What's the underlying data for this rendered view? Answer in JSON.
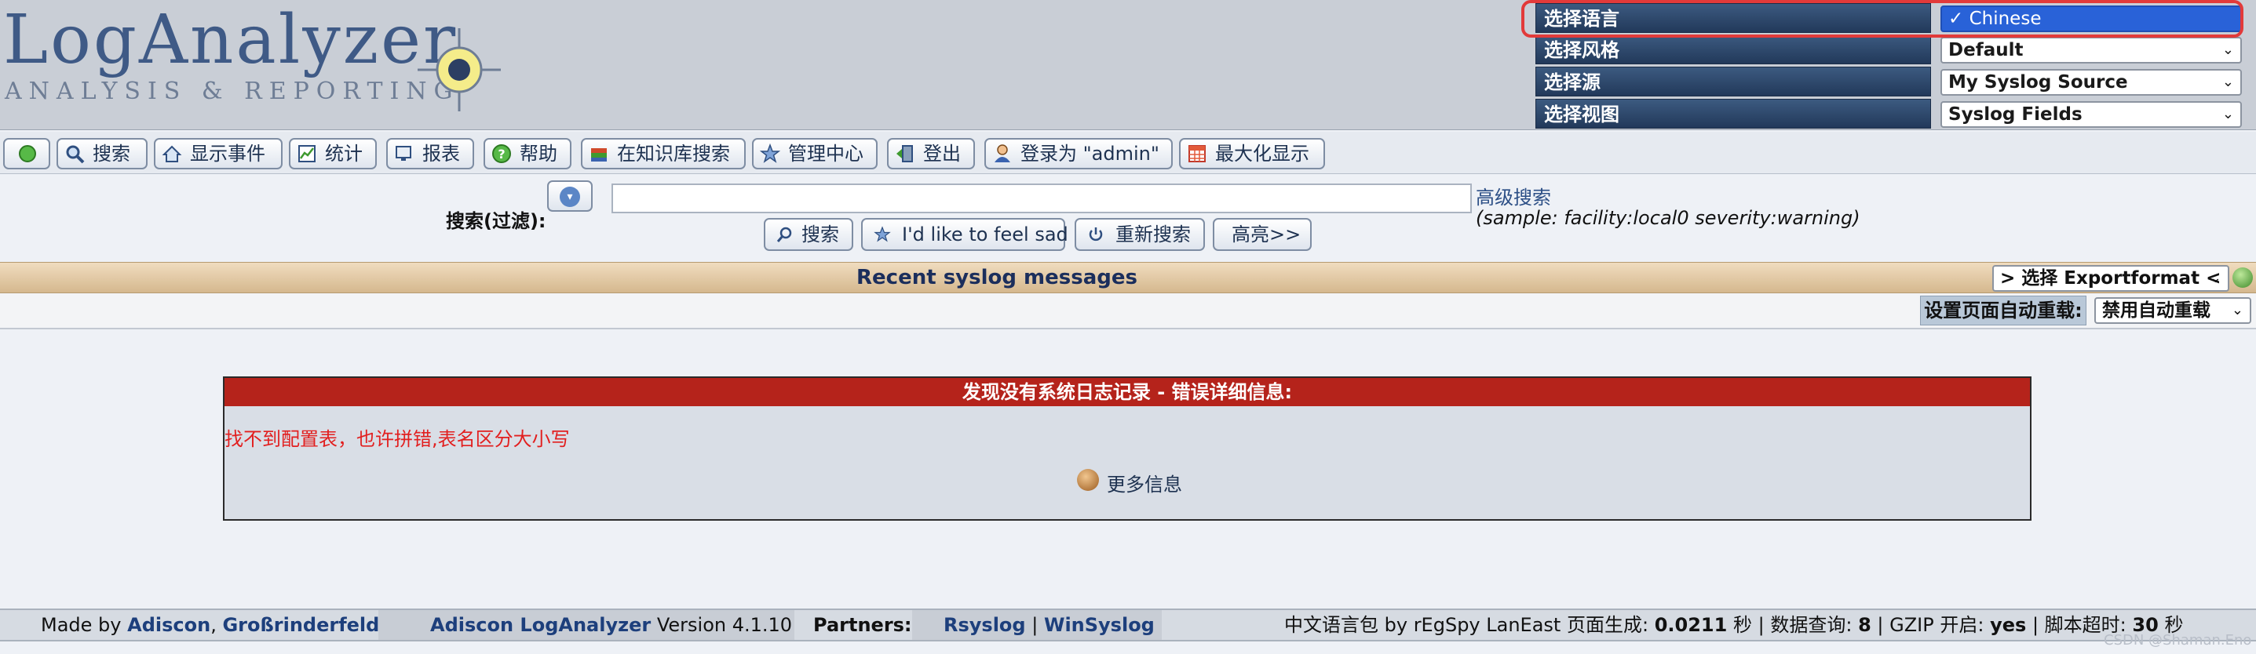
{
  "logo": {
    "title": "LogAnalyzer",
    "subtitle": "ANALYSIS & REPORTING"
  },
  "settings": [
    {
      "label": "选择语言",
      "value": "✓ Chinese",
      "open": true
    },
    {
      "label": "选择风格",
      "value": "Default"
    },
    {
      "label": "选择源",
      "value": "My Syslog Source"
    },
    {
      "label": "选择视图",
      "value": "Syslog Fields"
    }
  ],
  "toolbar": {
    "items": [
      {
        "label": ""
      },
      {
        "label": "搜索"
      },
      {
        "label": "显示事件"
      },
      {
        "label": "统计"
      },
      {
        "label": "报表"
      },
      {
        "label": "帮助"
      },
      {
        "label": "在知识库搜索"
      },
      {
        "label": "管理中心"
      },
      {
        "label": "登出"
      },
      {
        "label": "登录为 \"admin\""
      },
      {
        "label": "最大化显示"
      }
    ]
  },
  "search": {
    "label": "搜索(过滤):",
    "value": "",
    "advanced": "高级搜索",
    "sample": "(sample: facility:local0 severity:warning)",
    "buttons": {
      "search": "搜索",
      "feel_sad": "I'd like to feel sad",
      "reset": "重新搜索",
      "highlight": "高亮>>"
    }
  },
  "recent": {
    "title": "Recent syslog messages",
    "export_value": "> 选择 Exportformat <"
  },
  "reload": {
    "label": "设置页面自动重载:",
    "value": "禁用自动重载"
  },
  "error": {
    "header": "发现没有系统日志记录 - 错误详细信息:",
    "message": "找不到配置表，也许拼错,表名区分大小写",
    "more_info": "更多信息"
  },
  "footer": {
    "made_by": "Made by",
    "adiscon": "Adiscon",
    "comma": ",",
    "grossrinderfeld": "Großrinderfeld",
    "product": "Adiscon LogAnalyzer",
    "version": "Version 4.1.10",
    "partners_label": "Partners:",
    "rsyslog": "Rsyslog",
    "sep": "|",
    "winsyslog": "WinSyslog",
    "lang_pack": "中文语言包 by rEgSpy LanEast 页面生成:",
    "gen_time": "0.0211",
    "sec1": "秒",
    "db_label": "| 数据查询:",
    "db_queries": "8",
    "gzip_label": "| GZIP 开启:",
    "gzip_value": "yes",
    "timeout_label": "| 脚本超时:",
    "timeout_value": "30",
    "sec2": "秒"
  },
  "watermark": "CSDN @Shaman.Eno",
  "colors": {
    "error_red": "#b5231b",
    "nav_blue": "#22395a",
    "highlight": "#e23a3a"
  }
}
